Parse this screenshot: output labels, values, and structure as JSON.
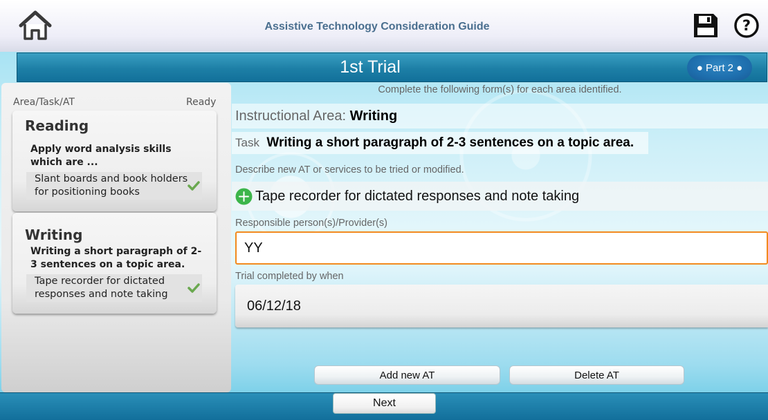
{
  "header": {
    "app_title": "Assistive Technology Consideration Guide",
    "home_icon": "home-icon",
    "save_icon": "floppy-disk-icon",
    "help_icon": "question-mark-icon"
  },
  "trial": {
    "title": "1st Trial",
    "part_label": "● Part 2 ●",
    "instructions": "Complete the following form(s) for each area identified."
  },
  "sidebar": {
    "col_left": "Area/Task/AT",
    "col_right": "Ready",
    "cards": [
      {
        "area": "Reading",
        "task": "Apply word analysis skills which are ...",
        "at": "Slant boards and book holders for positioning books",
        "ready": true
      },
      {
        "area": "Writing",
        "task": "Writing a short paragraph of 2-3 sentences on a topic area.",
        "at": "Tape recorder for dictated responses and note taking",
        "ready": true
      }
    ]
  },
  "form": {
    "instr_area_label": "Instructional Area:",
    "instr_area_value": "Writing",
    "task_label": "Task",
    "task_value": "Writing a short paragraph of 2-3 sentences on a topic area.",
    "describe_label": "Describe new AT or services to be tried or modified.",
    "at_value": "Tape recorder for dictated responses and note taking",
    "person_label": "Responsible person(s)/Provider(s)",
    "person_value": "YY",
    "when_label": "Trial completed by when",
    "when_value": "06/12/18"
  },
  "buttons": {
    "add_at": "Add new AT",
    "delete_at": "Delete AT",
    "next": "Next"
  },
  "colors": {
    "accent_orange": "#f28a1e",
    "title_bar_blue": "#1d7fa6",
    "check_green": "#6aa84f",
    "plus_green": "#3cb54a"
  }
}
